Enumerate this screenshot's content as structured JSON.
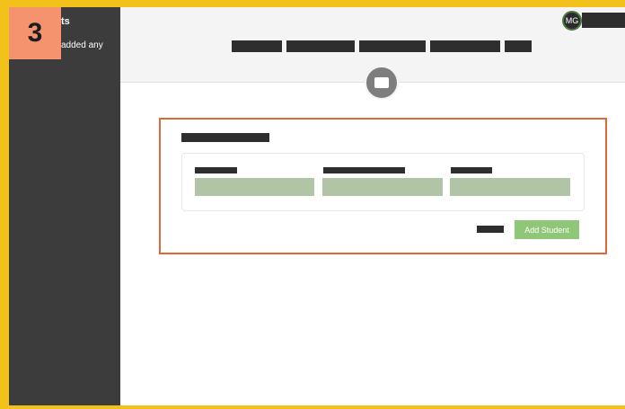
{
  "step": {
    "number": "3"
  },
  "sidebar": {
    "title": "ts",
    "text": "added any"
  },
  "header": {
    "avatar_initials": "MG"
  },
  "form": {
    "submit_label": "Add Student"
  },
  "colors": {
    "highlight_border": "#e0663c",
    "frame": "#f2c21b",
    "step_badge": "#f5936e",
    "sidebar_bg": "#3c3c3c",
    "input_fill": "#b2c4a6",
    "button_fill": "#8fc677"
  },
  "icons": {
    "center": "message-icon"
  }
}
